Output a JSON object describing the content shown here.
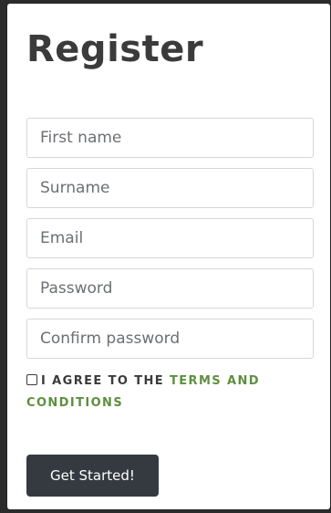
{
  "form": {
    "title": "Register",
    "fields": [
      {
        "placeholder": "First name",
        "value": ""
      },
      {
        "placeholder": "Surname",
        "value": ""
      },
      {
        "placeholder": "Email",
        "value": ""
      },
      {
        "placeholder": "Password",
        "value": ""
      },
      {
        "placeholder": "Confirm password",
        "value": ""
      }
    ],
    "agree": {
      "prefix": "I AGREE TO THE ",
      "link": "TERMS AND CONDITIONS",
      "checked": false
    },
    "submit_label": "Get Started!"
  },
  "colors": {
    "title": "#3b3b3b",
    "link": "#5e8f3e",
    "button_bg": "#343a40",
    "button_text": "#ffffff",
    "input_border": "#d4d7db"
  }
}
